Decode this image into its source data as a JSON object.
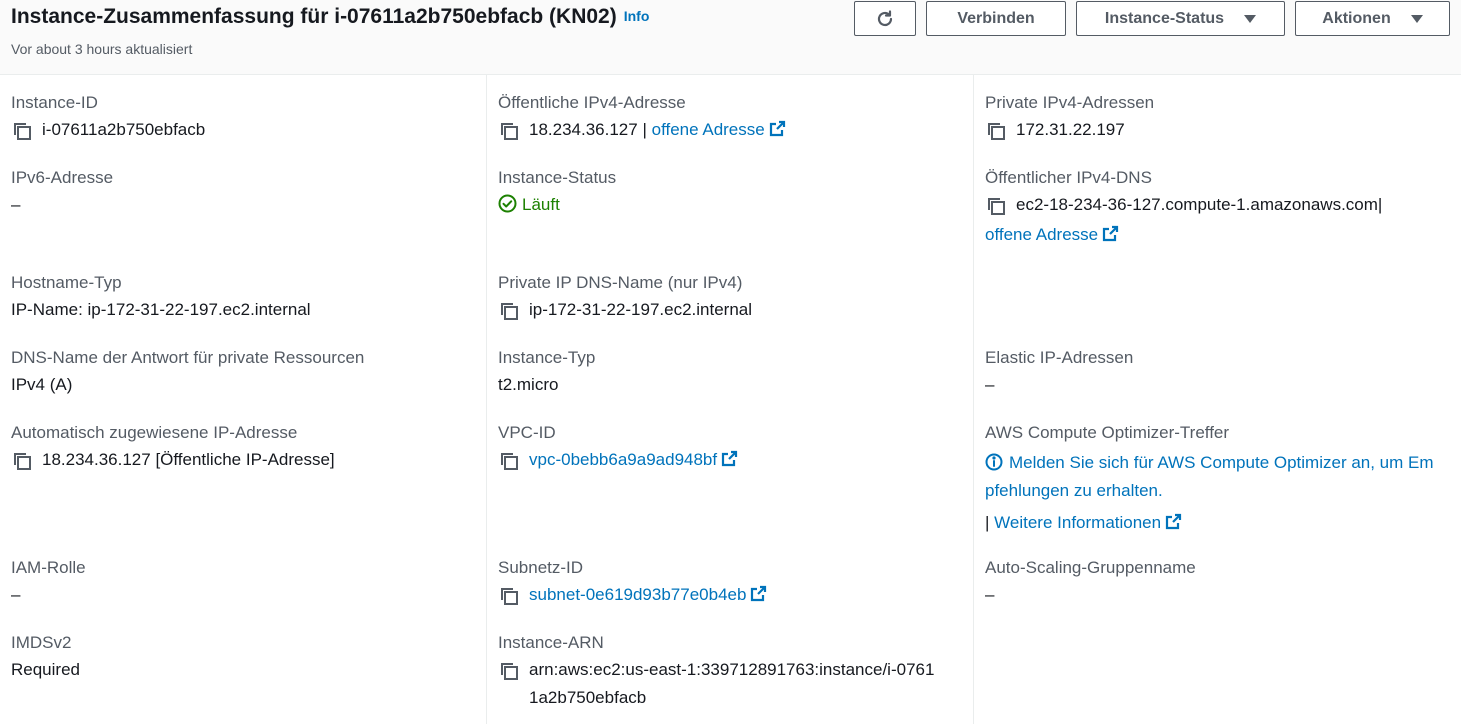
{
  "header": {
    "title": "Instance-Zusammenfassung für i-07611a2b750ebfacb (KN02)",
    "info_label": "Info",
    "updated": "Vor about 3 hours aktualisiert",
    "buttons": {
      "refresh_icon": "refresh-icon",
      "connect": "Verbinden",
      "instance_status": "Instance-Status",
      "actions": "Aktionen"
    }
  },
  "fields": {
    "instance_id": {
      "label": "Instance-ID",
      "value": "i-07611a2b750ebfacb"
    },
    "public_ipv4": {
      "label": "Öffentliche IPv4-Adresse",
      "value": "18.234.36.127",
      "separator": "|",
      "link": "offene Adresse"
    },
    "private_ipv4": {
      "label": "Private IPv4-Adressen",
      "value": "172.31.22.197"
    },
    "ipv6": {
      "label": "IPv6-Adresse",
      "value": "–"
    },
    "instance_status": {
      "label": "Instance-Status",
      "value": "Läuft"
    },
    "public_dns": {
      "label": "Öffentlicher IPv4-DNS",
      "value": "ec2-18-234-36-127.compute-1.amazonaws.com",
      "separator": "|",
      "link": "offene Adresse"
    },
    "hostname_type": {
      "label": "Hostname-Typ",
      "value": "IP-Name: ip-172-31-22-197.ec2.internal"
    },
    "private_dns": {
      "label": "Private IP DNS-Name (nur IPv4)",
      "value": "ip-172-31-22-197.ec2.internal"
    },
    "dns_answer": {
      "label": "DNS-Name der Antwort für private Ressourcen",
      "value": "IPv4 (A)"
    },
    "instance_type": {
      "label": "Instance-Typ",
      "value": "t2.micro"
    },
    "elastic_ip": {
      "label": "Elastic IP-Adressen",
      "value": "–"
    },
    "auto_ip": {
      "label": "Automatisch zugewiesene IP-Adresse",
      "value": "18.234.36.127 [Öffentliche IP-Adresse]"
    },
    "vpc_id": {
      "label": "VPC-ID",
      "value": "vpc-0bebb6a9a9ad948bf"
    },
    "optimizer": {
      "label": "AWS Compute Optimizer-Treffer",
      "line1": "Melden Sie sich für AWS Compute Optimizer an, um Em",
      "line2": "pfehlungen zu erhalten.",
      "separator": "|",
      "more": "Weitere Informationen"
    },
    "iam_role": {
      "label": "IAM-Rolle",
      "value": "–"
    },
    "subnet_id": {
      "label": "Subnetz-ID",
      "value": "subnet-0e619d93b77e0b4eb"
    },
    "asg_name": {
      "label": "Auto-Scaling-Gruppenname",
      "value": "–"
    },
    "imdsv2": {
      "label": "IMDSv2",
      "value": "Required"
    },
    "instance_arn": {
      "label": "Instance-ARN",
      "line1": "arn:aws:ec2:us-east-1:339712891763:instance/i-0761",
      "line2": "1a2b750ebfacb"
    }
  },
  "colors": {
    "link": "#0073bb",
    "success": "#1d8102",
    "text": "#16191f",
    "label": "#545b64"
  }
}
